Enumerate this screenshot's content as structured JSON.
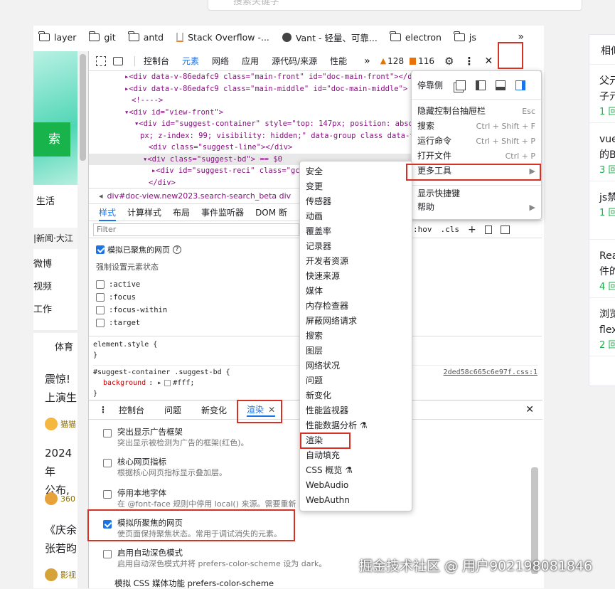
{
  "top_search": {
    "placeholder": "搜索关键字"
  },
  "bookmarks": [
    "layer",
    "git",
    "antd",
    "Stack Overflow -...",
    "Vant - 轻量、可靠...",
    "electron",
    "js"
  ],
  "bookmarks_more": "»",
  "left_page": {
    "button_text": "索",
    "nav1": "生活",
    "news_bar": "|新闻·大江",
    "links": [
      "微博",
      "视频",
      "工作"
    ],
    "tab_sports": "体育",
    "card1": [
      "震惊!",
      "上演生"
    ],
    "src1": "猫猫",
    "card2": [
      "2024年",
      "公布,"
    ],
    "src2": "360",
    "card3": [
      "《庆余",
      "张若昀"
    ],
    "src3": "影视"
  },
  "devtools": {
    "tabs": [
      "控制台",
      "元素",
      "网络",
      "应用",
      "源代码/来源",
      "性能"
    ],
    "active_tab": "元素",
    "more": "»",
    "warnings": "128",
    "issues": "116",
    "dom_lines": [
      {
        "indent": 50,
        "html": "▸<div data-v-86edafc9 class=\"main-front\" id=\"doc-main-front\"></div>"
      },
      {
        "indent": 50,
        "html": "▸<div data-v-86edafc9 class=\"main-middle\" id=\"doc-main-middle\">"
      },
      {
        "indent": 60,
        "html": "<!---->"
      },
      {
        "indent": 50,
        "html": "▾<div id=\"view-front\">"
      },
      {
        "indent": 64,
        "html": "▾<div id=\"suggest-container\" style=\"top: 147px; position: absolu"
      },
      {
        "indent": 72,
        "html": "px; z-index: 99; visibility: hidden;\" data-group class data-typ"
      },
      {
        "indent": 84,
        "html": "<div class=\"suggest-line\"></div>"
      },
      {
        "indent": 76,
        "html": "▾<div class=\"suggest-bd\"> == $0"
      },
      {
        "indent": 88,
        "html": "▸<div id=\"suggest-reci\" class=\"gc"
      },
      {
        "indent": 84,
        "html": "</div>"
      }
    ],
    "breadcrumb": "div#doc-view.new2023.search-search_beta   div",
    "style_tabs": [
      "样式",
      "计算样式",
      "布局",
      "事件监听器",
      "DOM 断"
    ],
    "filter_placeholder": "Filter",
    "hov": ":hov",
    "cls": ".cls",
    "emulate_focus": "模拟已聚焦的网页",
    "force_state_title": "强制设置元素状态",
    "states": [
      ":active",
      ":focus",
      ":focus-within",
      ":target"
    ],
    "element_style": "element.style {",
    "close_brace": "}",
    "rule_selector": "#suggest-container .suggest-bd {",
    "rule_source": "2ded58c665c6e97f.css:1",
    "rule_prop": "background",
    "rule_val": "#fff;",
    "drawer_tabs": [
      "控制台",
      "问题",
      "新变化",
      "渲染"
    ],
    "drawer_active": "渲染",
    "render_items": [
      {
        "title": "突出显示广告框架",
        "desc": "突出显示被检测为广告的框架(红色)。",
        "checked": false
      },
      {
        "title": "核心网页指标",
        "desc": "根据核心网页指标显示叠加层。",
        "checked": false
      },
      {
        "title": "停用本地字体",
        "desc": "在 @font-face 规则中停用 local() 来源。需要重新",
        "checked": false
      },
      {
        "title": "模拟所聚焦的网页",
        "desc": "使页面保持聚焦状态。常用于调试消失的元素。",
        "checked": true
      },
      {
        "title": "启用自动深色模式",
        "desc": "启用自动深色模式并将 prefers-color-scheme 设为 dark。",
        "checked": false
      }
    ],
    "render_last": "模拟 CSS 媒体功能 prefers-color-scheme"
  },
  "main_menu": {
    "dock_label": "停靠侧",
    "items": [
      {
        "label": "隐藏控制台抽屉栏",
        "shortcut": "Esc"
      },
      {
        "label": "搜索",
        "shortcut": "Ctrl + Shift + F"
      },
      {
        "label": "运行命令",
        "shortcut": "Ctrl + Shift + P"
      },
      {
        "label": "打开文件",
        "shortcut": "Ctrl + P"
      },
      {
        "label": "更多工具",
        "shortcut": "▶"
      },
      {
        "label": "显示快捷键",
        "shortcut": ""
      },
      {
        "label": "帮助",
        "shortcut": "▶"
      }
    ]
  },
  "more_tools": [
    "安全",
    "变更",
    "传感器",
    "动画",
    "覆盖率",
    "记录器",
    "开发者资源",
    "快速来源",
    "媒体",
    "内存检查器",
    "屏蔽网络请求",
    "搜索",
    "图层",
    "网络状况",
    "问题",
    "新变化",
    "性能监视器",
    "性能数据分析 ⚗",
    "渲染",
    "自动填充",
    "CSS 概览 ⚗",
    "WebAudio",
    "WebAuthn"
  ],
  "right_panel": {
    "header": "相似",
    "items": [
      {
        "l1": "父元",
        "l2": "子元",
        "c": "1 回"
      },
      {
        "l1": "vue",
        "l2": "的B",
        "c": "3 回"
      },
      {
        "l1": "js禁",
        "l2": "",
        "c": "1 回"
      },
      {
        "l1": "Rea",
        "l2": "件的",
        "c": "4 回"
      },
      {
        "l1": "浏览",
        "l2": "flex",
        "c": "2 回"
      }
    ]
  },
  "watermark": "掘金技术社区 @ 用户902198081846",
  "colors": {
    "accent": "#1a73e8",
    "red": "#d93025",
    "green": "#18b34a"
  }
}
